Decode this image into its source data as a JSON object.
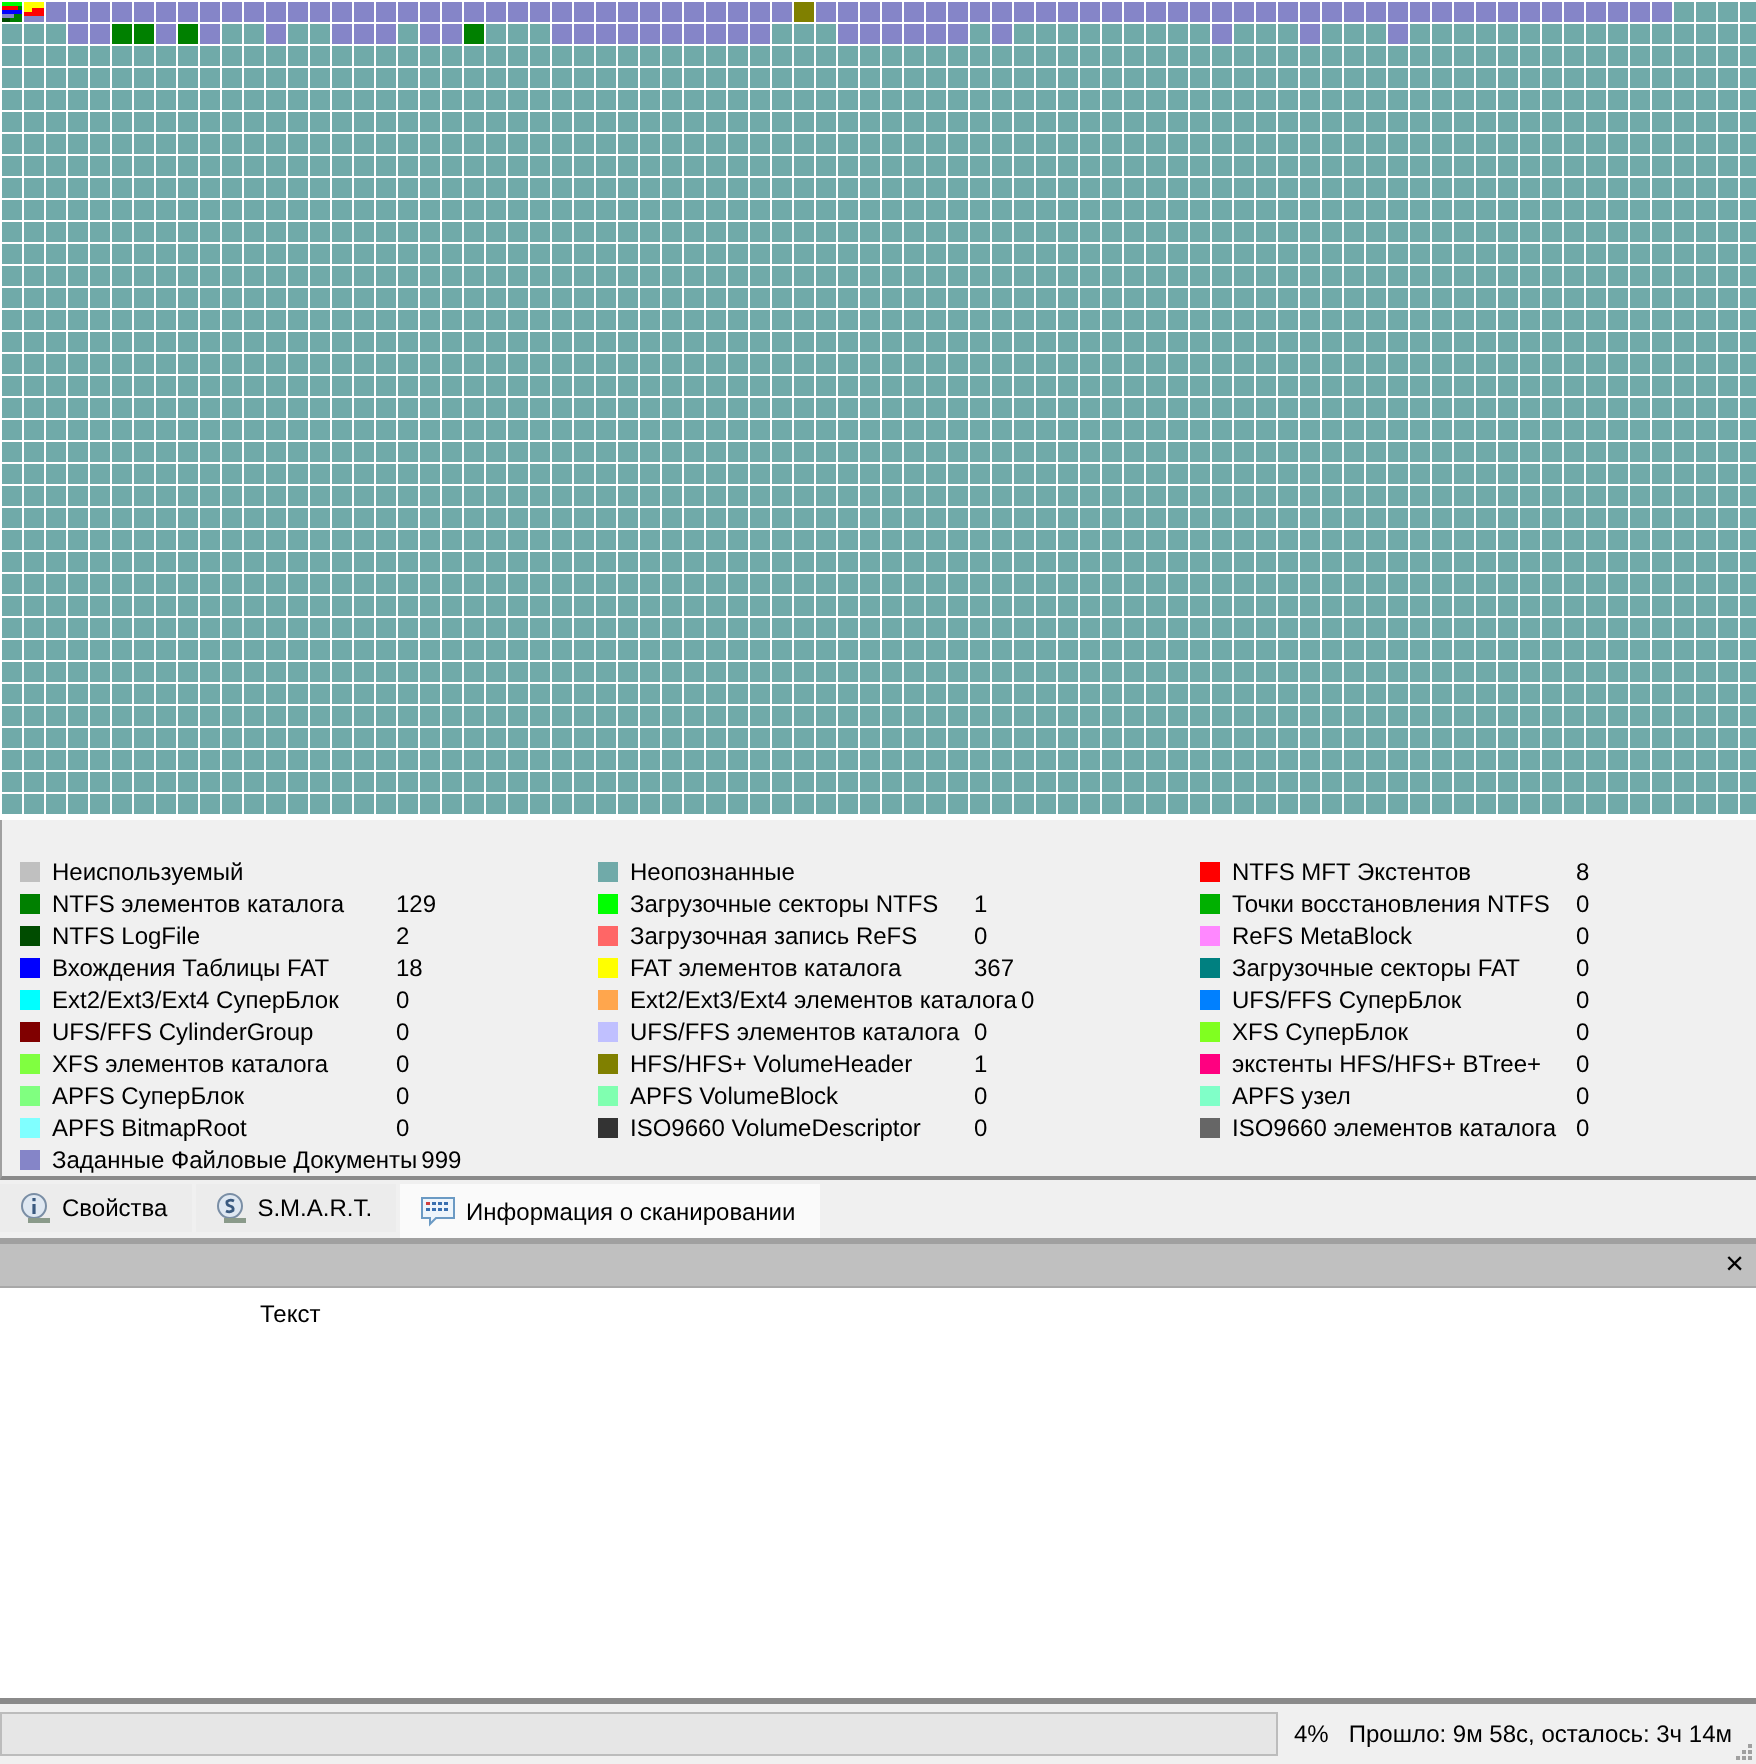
{
  "legend": [
    {
      "label": "Неиспользуемый",
      "color": "#c0c0c0"
    },
    {
      "label": "Неопознанные",
      "color": "#70aaa9"
    },
    {
      "label": "NTFS MFT Экстентов",
      "count": "8",
      "color": "#ff0000"
    },
    {
      "label": "NTFS элементов каталога",
      "count": "129",
      "color": "#008000"
    },
    {
      "label": "Загрузочные секторы NTFS",
      "count": "1",
      "color": "#00ff00"
    },
    {
      "label": "Точки восстановления NTFS",
      "count": "0",
      "color": "#00b000"
    },
    {
      "label": "NTFS LogFile",
      "count": "2",
      "color": "#004c00"
    },
    {
      "label": "Загрузочная запись ReFS",
      "count": "0",
      "color": "#ff6666"
    },
    {
      "label": "ReFS MetaBlock",
      "count": "0",
      "color": "#ff88ff"
    },
    {
      "label": "Вхождения Таблицы FAT",
      "count": "18",
      "color": "#0000ff"
    },
    {
      "label": "FAT элементов каталога",
      "count": "367",
      "color": "#ffff00"
    },
    {
      "label": "Загрузочные секторы FAT",
      "count": "0",
      "color": "#008080"
    },
    {
      "label": "Ext2/Ext3/Ext4 СуперБлок",
      "count": "0",
      "color": "#00ffff"
    },
    {
      "label": "Ext2/Ext3/Ext4 элементов каталога",
      "count": "0",
      "color": "#ffa64d"
    },
    {
      "label": "UFS/FFS СуперБлок",
      "count": "0",
      "color": "#0080ff"
    },
    {
      "label": "UFS/FFS CylinderGroup",
      "count": "0",
      "color": "#800000"
    },
    {
      "label": "UFS/FFS элементов каталога",
      "count": "0",
      "color": "#c0c0ff"
    },
    {
      "label": "XFS СуперБлок",
      "count": "0",
      "color": "#80ff20"
    },
    {
      "label": "XFS элементов каталога",
      "count": "0",
      "color": "#80ff40"
    },
    {
      "label": "HFS/HFS+ VolumeHeader",
      "count": "1",
      "color": "#808000"
    },
    {
      "label": "экстенты HFS/HFS+ BTree+",
      "count": "0",
      "color": "#ff0080"
    },
    {
      "label": "APFS СуперБлок",
      "count": "0",
      "color": "#80ff80"
    },
    {
      "label": "APFS VolumeBlock",
      "count": "0",
      "color": "#80ffb0"
    },
    {
      "label": "APFS узел",
      "count": "0",
      "color": "#80ffc8"
    },
    {
      "label": "APFS BitmapRoot",
      "count": "0",
      "color": "#80ffff"
    },
    {
      "label": "ISO9660 VolumeDescriptor",
      "count": "0",
      "color": "#333333"
    },
    {
      "label": "ISO9660 элементов каталога",
      "count": "0",
      "color": "#666666"
    },
    {
      "label": "Заданные Файловые Документы",
      "count": "999",
      "color": "#8585c8"
    }
  ],
  "tabs": [
    {
      "label": "Свойства",
      "kind": "info",
      "selected": false
    },
    {
      "label": "S.M.A.R.T.",
      "kind": "smart",
      "selected": false
    },
    {
      "label": "Информация о сканировании",
      "kind": "scan",
      "selected": true
    }
  ],
  "panel": {
    "close": "×",
    "column": "Текст"
  },
  "status_bar": {
    "level": 0,
    "percent": "4%",
    "time": "Прошло: 9м 58с, осталось: 3ч 14м"
  }
}
